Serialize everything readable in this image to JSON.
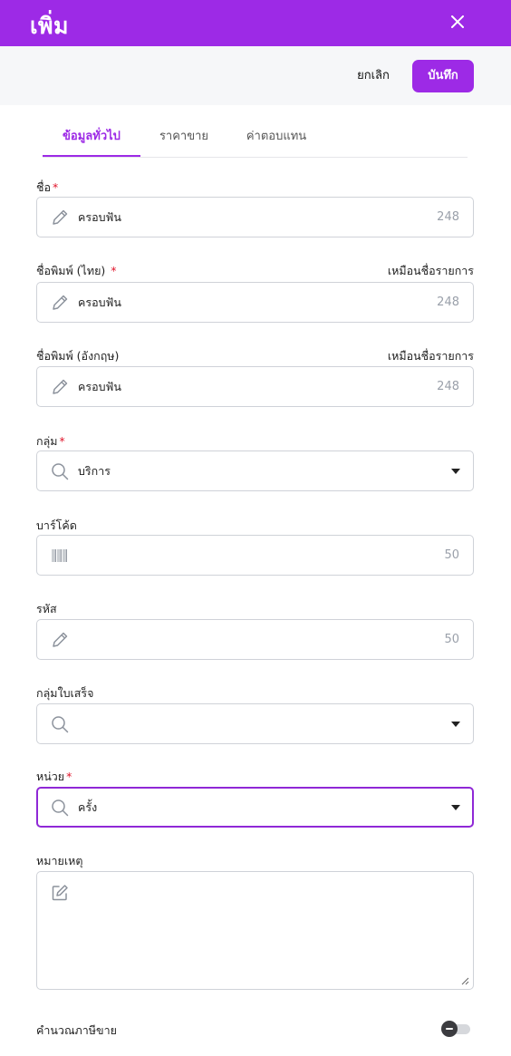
{
  "header": {
    "title": "เพิ่ม",
    "close_icon": "close-icon"
  },
  "actions": {
    "cancel_label": "ยกเลิก",
    "save_label": "บันทึก"
  },
  "tabs": [
    {
      "label": "ข้อมูลทั่วไป",
      "active": true
    },
    {
      "label": "ราคาขาย",
      "active": false
    },
    {
      "label": "ค่าตอบแทน",
      "active": false
    }
  ],
  "form": {
    "name": {
      "label": "ชื่อ",
      "required": "*",
      "value": "ครอบฟัน",
      "count": "248",
      "icon": "pencil-icon"
    },
    "print_name_th": {
      "label": "ชื่อพิมพ์ (ไทย)",
      "required": "*",
      "link": "เหมือนชื่อรายการ",
      "value": "ครอบฟัน",
      "count": "248",
      "icon": "pencil-icon"
    },
    "print_name_en": {
      "label": "ชื่อพิมพ์ (อังกฤษ)",
      "link": "เหมือนชื่อรายการ",
      "value": "ครอบฟัน",
      "count": "248",
      "icon": "pencil-icon"
    },
    "group": {
      "label": "กลุ่ม",
      "required": "*",
      "value": "บริการ",
      "icon": "search-icon"
    },
    "barcode": {
      "label": "บาร์โค้ด",
      "value": "",
      "count": "50",
      "icon": "barcode-icon"
    },
    "code": {
      "label": "รหัส",
      "value": "",
      "count": "50",
      "icon": "pencil-icon"
    },
    "receipt_group": {
      "label": "กลุ่มใบเสร็จ",
      "value": "",
      "icon": "search-icon"
    },
    "unit": {
      "label": "หน่วย",
      "required": "*",
      "value": "ครั้ง",
      "icon": "search-icon"
    },
    "note": {
      "label": "หมายเหตุ",
      "value": "",
      "icon": "edit-icon"
    },
    "sales_tax": {
      "label": "คำนวณภาษีขาย",
      "enabled": false
    }
  },
  "colors": {
    "accent": "#9d2ae6",
    "required": "#e0152b",
    "border": "#cfd2d8",
    "muted": "#9aa0aa"
  }
}
